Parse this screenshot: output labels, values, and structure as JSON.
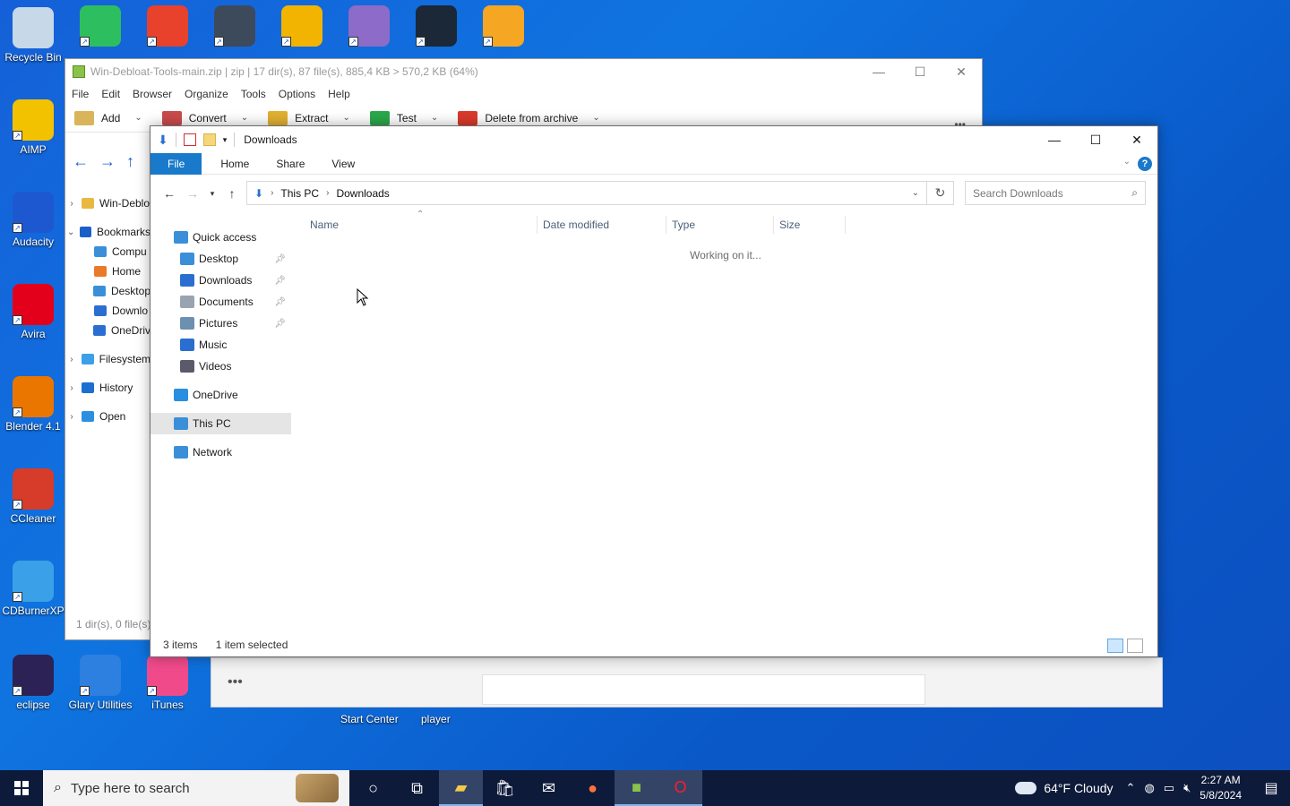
{
  "desktop": {
    "icons": [
      {
        "label": "Recycle Bin",
        "icon": "recycle-bin-icon",
        "color": "#c7d8e8"
      },
      {
        "label": "AIMP",
        "icon": "aimp-icon",
        "color": "#f2c200"
      },
      {
        "label": "Audacity",
        "icon": "audacity-icon",
        "color": "#1e58d0"
      },
      {
        "label": "Avira",
        "icon": "avira-icon",
        "color": "#e2001a"
      },
      {
        "label": "Blender 4.1",
        "icon": "blender-icon",
        "color": "#ea7600"
      },
      {
        "label": "CCleaner",
        "icon": "ccleaner-icon",
        "color": "#d73b2a"
      },
      {
        "label": "CDBurnerXP",
        "icon": "cdburner-icon",
        "color": "#3aa0e8"
      },
      {
        "label": "eclipse",
        "icon": "eclipse-icon",
        "color": "#2c2255"
      },
      {
        "label": "Glary Utilities",
        "icon": "glary-icon",
        "color": "#2d7fe0"
      },
      {
        "label": "iTunes",
        "icon": "itunes-icon",
        "color": "#f04a8a"
      }
    ],
    "top_icons": [
      {
        "icon": "evernote-icon",
        "color": "#2dbe60"
      },
      {
        "icon": "gom-player-icon",
        "color": "#e8412c"
      },
      {
        "icon": "keepass-icon",
        "color": "#3d4a5c"
      },
      {
        "icon": "musicbee-icon",
        "color": "#f2b400"
      },
      {
        "icon": "pidgin-icon",
        "color": "#8c6cc8"
      },
      {
        "icon": "steam-icon",
        "color": "#1b2838"
      },
      {
        "icon": "winamp-icon",
        "color": "#f5a623"
      }
    ],
    "behind_labels": [
      "Start Center",
      "player"
    ]
  },
  "zip_window": {
    "title": "Win-Debloat-Tools-main.zip | zip | 17 dir(s), 87 file(s), 885,4 KB > 570,2 KB (64%)",
    "menu": [
      "File",
      "Edit",
      "Browser",
      "Organize",
      "Tools",
      "Options",
      "Help"
    ],
    "toolbar": [
      {
        "label": "Add",
        "color": "#d9b45a"
      },
      {
        "label": "Convert",
        "color": "#c94b4b"
      },
      {
        "label": "Extract",
        "color": "#e0b030"
      },
      {
        "label": "Test",
        "color": "#2aa84a"
      },
      {
        "label": "Delete from archive",
        "color": "#d93a2b"
      }
    ],
    "more": "•••",
    "tree": [
      {
        "label": "Win-Deblo",
        "expander": "›",
        "color": "#e8b840"
      },
      {
        "label": "Bookmarks",
        "expander": "⌄",
        "color": "#1a5fc8"
      },
      {
        "label": "Compu",
        "expander": "",
        "color": "#3b8fd9"
      },
      {
        "label": "Home",
        "expander": "",
        "color": "#e87a2a"
      },
      {
        "label": "Desktop",
        "expander": "",
        "color": "#3b8fd9"
      },
      {
        "label": "Downlo",
        "expander": "",
        "color": "#2a6fd0"
      },
      {
        "label": "OneDriv",
        "expander": "",
        "color": "#2a6fd0"
      },
      {
        "label": "Filesystem",
        "expander": "›",
        "color": "#3ba0e8"
      },
      {
        "label": "History",
        "expander": "›",
        "color": "#1a6fd0"
      },
      {
        "label": "Open",
        "expander": "›",
        "color": "#2a8fe0"
      }
    ],
    "status": "1 dir(s), 0 file(s),"
  },
  "explorer": {
    "title": "Downloads",
    "ribbon_tabs": [
      "File",
      "Home",
      "Share",
      "View"
    ],
    "help": "?",
    "breadcrumb": [
      "This PC",
      "Downloads"
    ],
    "search_placeholder": "Search Downloads",
    "nav": [
      {
        "label": "Quick access",
        "color": "#3b8fd9",
        "pinned": false,
        "level": "top"
      },
      {
        "label": "Desktop",
        "color": "#3b8fd9",
        "pinned": true,
        "level": "sub"
      },
      {
        "label": "Downloads",
        "color": "#2a6fd0",
        "pinned": true,
        "level": "sub"
      },
      {
        "label": "Documents",
        "color": "#9aa4b0",
        "pinned": true,
        "level": "sub"
      },
      {
        "label": "Pictures",
        "color": "#6d8fb0",
        "pinned": true,
        "level": "sub"
      },
      {
        "label": "Music",
        "color": "#2a6fd0",
        "pinned": false,
        "level": "sub"
      },
      {
        "label": "Videos",
        "color": "#5a5a6a",
        "pinned": false,
        "level": "sub"
      },
      {
        "label": "OneDrive",
        "color": "#2a8fe0",
        "pinned": false,
        "level": "top"
      },
      {
        "label": "This PC",
        "color": "#3b8fd9",
        "pinned": false,
        "level": "top"
      },
      {
        "label": "Network",
        "color": "#3b8fd9",
        "pinned": false,
        "level": "top"
      }
    ],
    "columns": [
      "Name",
      "Date modified",
      "Type",
      "Size"
    ],
    "empty_message": "Working on it...",
    "status": {
      "items": "3 items",
      "selected": "1 item selected"
    }
  },
  "taskbar": {
    "search_placeholder": "Type here to search",
    "weather": "64°F  Cloudy",
    "time": "2:27 AM",
    "date": "5/8/2024",
    "apps": [
      "cortana-icon",
      "task-view-icon",
      "file-explorer-icon",
      "store-icon",
      "mail-icon",
      "firefox-icon",
      "archiver-icon",
      "opera-icon"
    ]
  }
}
